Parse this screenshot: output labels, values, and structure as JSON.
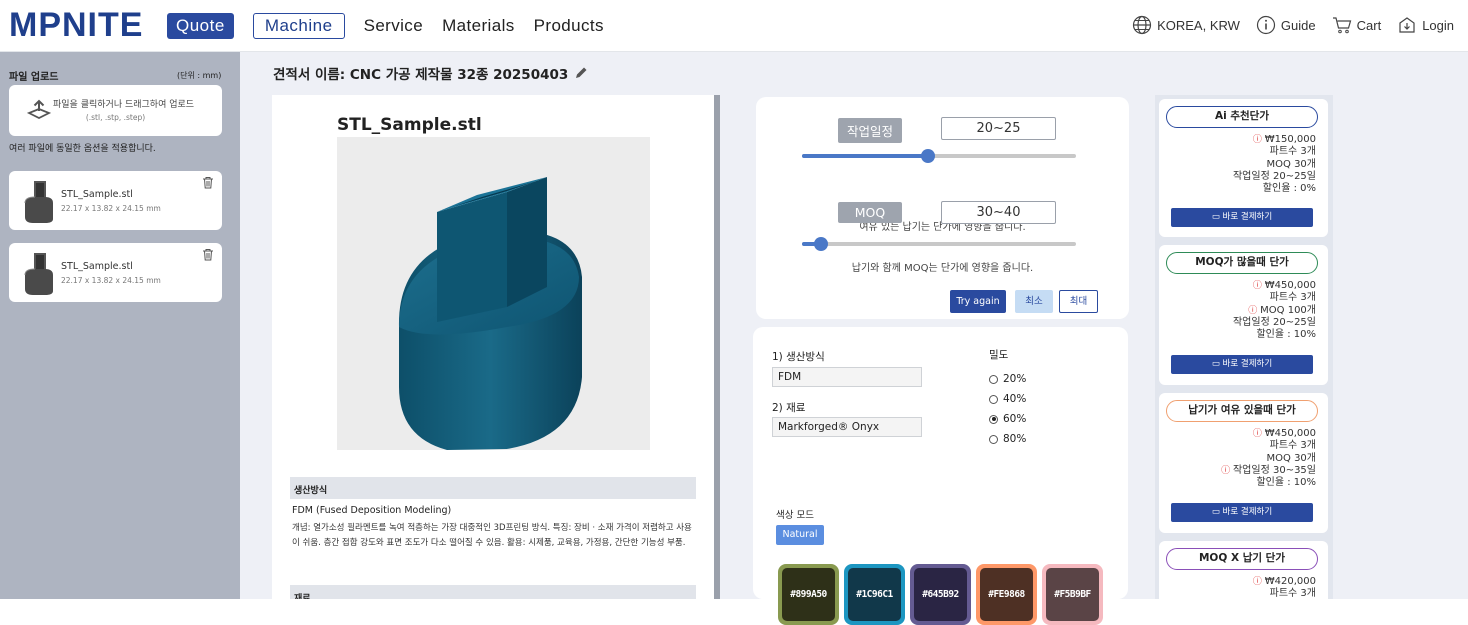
{
  "header": {
    "logo": "MPNITE",
    "nav": {
      "quote": "Quote",
      "machine": "Machine",
      "service": "Service",
      "materials": "Materials",
      "products": "Products"
    },
    "region": "KOREA, KRW",
    "guide": "Guide",
    "cart": "Cart",
    "login": "Login"
  },
  "sidebar": {
    "title": "파일 업로드",
    "unit": "(단위 : mm)",
    "upload_text": "파일을 클릭하거나 드래그하여 업로드",
    "upload_formats": "(.stl, .stp, .step)",
    "note": "여러 파일에 동일한 옵션을 적용합니다.",
    "files": [
      {
        "name": "STL_Sample.stl",
        "dims": "22.17 x 13.82 x 24.15 mm"
      },
      {
        "name": "STL_Sample.stl",
        "dims": "22.17 x 13.82 x 24.15 mm"
      }
    ]
  },
  "quote": {
    "title": "견적서 이름: CNC 가공 제작물 32종 20250403"
  },
  "preview": {
    "filename": "STL_Sample.stl",
    "section1": "생산방식",
    "method_title": "FDM (Fused Deposition Modeling)",
    "method_desc": "개념: 열가소성 필라멘트를 녹여 적층하는 가장 대중적인 3D프린팅 방식. 특징: 장비 · 소재 가격이 저렴하고 사용이 쉬움. 층간 접합 강도와 표면 조도가 다소 떨어질 수 있음. 활용: 시제품, 교육용, 가정용, 간단한 기능성 부품.",
    "section2": "재료"
  },
  "options": {
    "schedule_label": "작업일정",
    "schedule_value": "20~25",
    "schedule_level": 0.46,
    "schedule_hint": "여유 있는 납기는 단가에 영향을 줍니다.",
    "moq_label": "MOQ",
    "moq_value": "30~40",
    "moq_level": 0.07,
    "moq_hint": "납기와 함께 MOQ는 단가에 영향을 줍니다.",
    "try_again": "Try again",
    "min": "최소",
    "max": "최대"
  },
  "spec": {
    "method_label": "1) 생산방식",
    "method_value": "FDM",
    "material_label": "2) 재료",
    "material_value": "Markforged® Onyx",
    "density_label": "밀도",
    "density_options": [
      "20%",
      "40%",
      "60%",
      "80%"
    ],
    "density_selected": "60%",
    "color_label": "색상 모드",
    "color_mode": "Natural",
    "swatches": [
      {
        "label": "#899A50",
        "color": "#899A50",
        "inner": "#2e3018"
      },
      {
        "label": "#1C96C1",
        "color": "#1C96C1",
        "inner": "#11384a"
      },
      {
        "label": "#645B92",
        "color": "#645B92",
        "inner": "#2a2544"
      },
      {
        "label": "#FE9868",
        "color": "#FE9868",
        "inner": "#4e3024"
      },
      {
        "label": "#F5B9BF",
        "color": "#F5B9BF",
        "inner": "#5a4446"
      }
    ]
  },
  "price_cards": [
    {
      "title": "Ai 추천단가",
      "border": "#2a4a9f",
      "lines": [
        {
          "text": "₩150,000",
          "warn": true
        },
        {
          "text": "파트수 3개"
        },
        {
          "text": "MOQ 30개"
        },
        {
          "text": "작업일정 20~25일"
        },
        {
          "text": "할인율 : 0%"
        }
      ],
      "button": "바로 결제하기"
    },
    {
      "title": "MOQ가 많을때 단가",
      "border": "#2e8b57",
      "lines": [
        {
          "text": "₩450,000",
          "warn": true
        },
        {
          "text": "파트수 3개"
        },
        {
          "text": "MOQ 100개",
          "warn": true
        },
        {
          "text": "작업일정 20~25일"
        },
        {
          "text": "할인율 : 10%"
        }
      ],
      "button": "바로 결제하기"
    },
    {
      "title": "납기가 여유 있을때 단가",
      "border": "#f0a070",
      "lines": [
        {
          "text": "₩450,000",
          "warn": true
        },
        {
          "text": "파트수 3개"
        },
        {
          "text": "MOQ 30개"
        },
        {
          "text": "작업일정 30~35일",
          "warn": true
        },
        {
          "text": "할인율 : 10%"
        }
      ],
      "button": "바로 결제하기"
    },
    {
      "title": "MOQ X 납기 단가",
      "border": "#8a4fb8",
      "lines": [
        {
          "text": "₩420,000",
          "warn": true
        },
        {
          "text": "파트수 3개"
        }
      ],
      "button": ""
    }
  ]
}
